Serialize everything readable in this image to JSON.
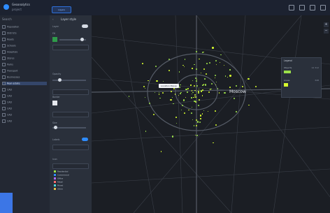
{
  "topbar": {
    "app_title": "Geoanalytics",
    "app_subtitle": "project",
    "filter_chip": "Layers",
    "icons": [
      "monitor-icon",
      "copy-icon",
      "settings-icon",
      "user-icon"
    ]
  },
  "sidebar": {
    "search": "Search",
    "items": [
      {
        "label": "Population"
      },
      {
        "label": "Districts"
      },
      {
        "label": "Roads"
      },
      {
        "label": "Schools"
      },
      {
        "label": "Hospitals"
      },
      {
        "label": "Stores"
      },
      {
        "label": "Parks"
      },
      {
        "label": "Transport"
      },
      {
        "label": "Businesses"
      },
      {
        "label": "Real estate",
        "active": true
      },
      {
        "label": "CAD"
      },
      {
        "label": "CAD"
      },
      {
        "label": "CAD"
      },
      {
        "label": "CAD"
      },
      {
        "label": "CAD"
      },
      {
        "label": "CAD"
      }
    ]
  },
  "panel": {
    "title": "Layer style",
    "back": "‹",
    "sections": {
      "layer": "Layer",
      "fill": "Fill",
      "opacity": "Opacity",
      "border": "Border",
      "size": "Size",
      "icon": "Icon",
      "labels": "Labels"
    },
    "legend_items": [
      {
        "label": "Residential",
        "color": "#9be04a"
      },
      {
        "label": "Commercial",
        "color": "#2e8cff"
      },
      {
        "label": "Office",
        "color": "#b06cff"
      },
      {
        "label": "Retail",
        "color": "#ff6c6c"
      },
      {
        "label": "Mixed",
        "color": "#4ad9d9"
      },
      {
        "label": "Other",
        "color": "#e0c04a"
      }
    ]
  },
  "map": {
    "tooltip": "Location Popup",
    "city_label": "Moscow",
    "legend": {
      "title": "Legend",
      "line1": "Objects",
      "line1_count": "12 312",
      "line2": "Areas",
      "line2_count": "348"
    },
    "zoom_in": "+",
    "zoom_out": "−"
  },
  "colors": {
    "accent": "#2e8cff",
    "poi_primary": "#9be04a",
    "poi_secondary": "#d8ff2e"
  }
}
